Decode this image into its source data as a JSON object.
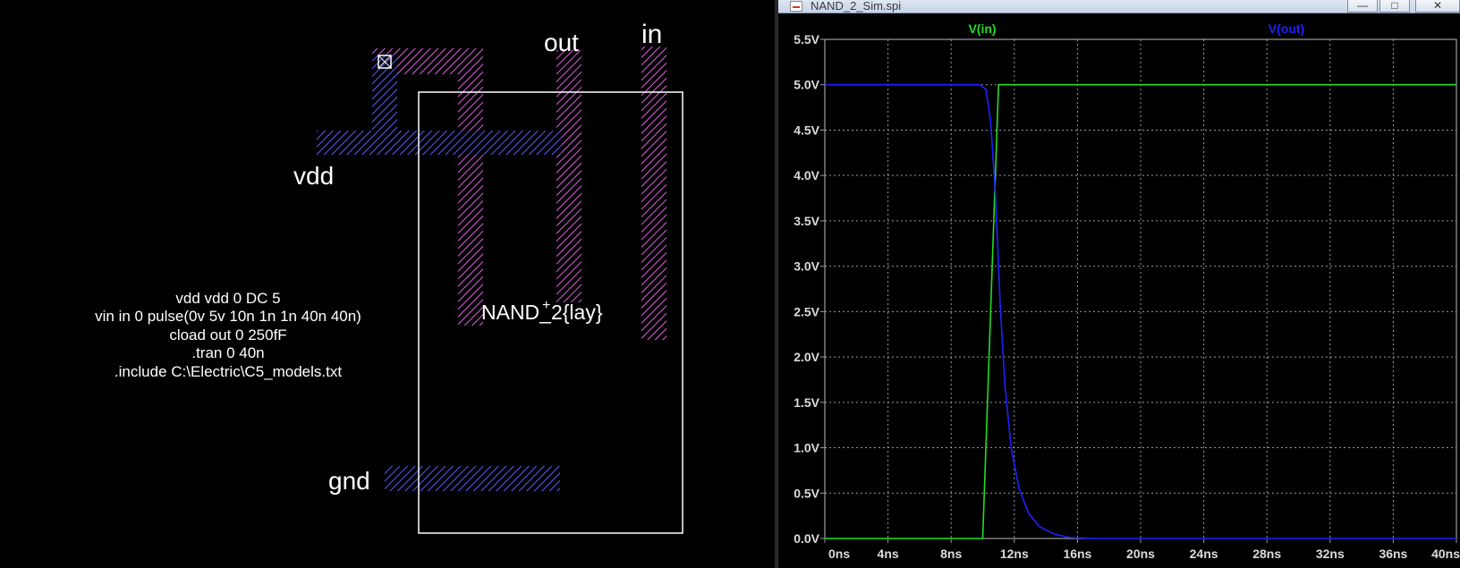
{
  "layout_view": {
    "labels": {
      "vdd": "vdd",
      "gnd": "gnd",
      "out": "out",
      "in": "in",
      "cell_name": "NAND_2{lay}"
    },
    "spice_directives": [
      "vdd vdd 0 DC 5",
      "vin in 0 pulse(0v 5v 10n 1n 1n 40n 40n)",
      "cload out 0 250fF",
      ".tran 0 40n",
      ".include C:\\Electric\\C5_models.txt"
    ],
    "colors": {
      "metal1": "#5b5bff",
      "metal2": "#e060e0",
      "cell_outline": "#ffffff",
      "text": "#ffffff"
    }
  },
  "waveform_window": {
    "title": "NAND_2_Sim.spi",
    "controls": {
      "minimize": "—",
      "maximize": "□",
      "close": "✕"
    },
    "icon": "plot-file-icon",
    "colors": {
      "background": "#000000",
      "grid": "#9a9a9a",
      "axis_text": "#dcdcdc",
      "vin": "#22dd22",
      "vout": "#2020ff"
    }
  },
  "chart_data": {
    "type": "line",
    "xlabel": "",
    "ylabel": "",
    "xlim": [
      0,
      40
    ],
    "ylim": [
      0,
      5.5
    ],
    "x_ticks": [
      "0ns",
      "4ns",
      "8ns",
      "12ns",
      "16ns",
      "20ns",
      "24ns",
      "28ns",
      "32ns",
      "36ns",
      "40ns"
    ],
    "y_ticks": [
      "0.0V",
      "0.5V",
      "1.0V",
      "1.5V",
      "2.0V",
      "2.5V",
      "3.0V",
      "3.5V",
      "4.0V",
      "4.5V",
      "5.0V",
      "5.5V"
    ],
    "grid": true,
    "series": [
      {
        "name": "V(in)",
        "color": "#22dd22",
        "x": [
          0,
          10,
          11,
          40
        ],
        "y": [
          0,
          0,
          5,
          5
        ]
      },
      {
        "name": "V(out)",
        "color": "#2020ff",
        "x": [
          0,
          9.8,
          10.2,
          10.5,
          10.8,
          11.1,
          11.4,
          11.8,
          12.3,
          12.9,
          13.6,
          14.5,
          15.5,
          17,
          40
        ],
        "y": [
          5,
          5,
          4.95,
          4.6,
          3.8,
          2.6,
          1.7,
          1.0,
          0.55,
          0.28,
          0.13,
          0.05,
          0.01,
          0,
          0
        ]
      }
    ]
  }
}
